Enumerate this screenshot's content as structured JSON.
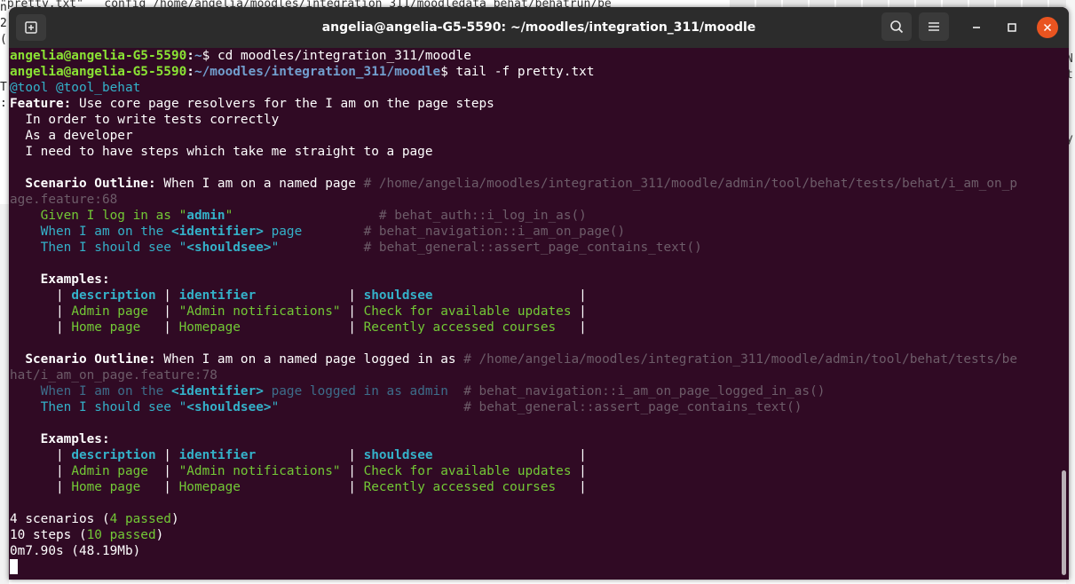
{
  "background": {
    "top_text": "\"pretty.txt\"   config /home/angelia/moodles/integration_311/moodledata_behat/behatrun/be",
    "left_text": "n\n2\n(\n\n\nT\n:",
    "right_glyphs": "\nN\nt\n\n\n\ny"
  },
  "window": {
    "title": "angelia@angelia-G5-5590: ~/moodles/integration_311/moodle"
  },
  "terminal": {
    "prompt_user": "angelia@angelia-G5-5590",
    "cmd1_path": "~",
    "cmd1": "cd moodles/integration_311/moodle",
    "cmd2_path": "~/moodles/integration_311/moodle",
    "cmd2": "tail -f pretty.txt",
    "tags": "@tool @tool_behat",
    "feature_kw": "Feature:",
    "feature_title": " Use core page resolvers for the I am on the page steps",
    "narrative": [
      "  In order to write tests correctly",
      "  As a developer",
      "  I need to have steps which take me straight to a page"
    ],
    "scenario1": {
      "kw": "  Scenario Outline:",
      "title": " When I am on a named page ",
      "path1": "# /home/angelia/moodles/integration_311/moodle/admin/tool/behat/tests/behat/i_am_on_p",
      "path2": "age.feature:68",
      "steps": [
        {
          "kw": "    Given",
          "text1": " I log in as \"",
          "arg": "admin",
          "text2": "\"",
          "pad": "                   ",
          "ref": "# behat_auth::i_log_in_as()"
        },
        {
          "kw": "    When",
          "text1": " I am on the ",
          "arg": "<identifier>",
          "text2": " page",
          "pad": "        ",
          "ref": "# behat_navigation::i_am_on_page()"
        },
        {
          "kw": "    Then",
          "text1": " I should see \"",
          "arg": "<shouldsee>",
          "text2": "\"",
          "pad": "           ",
          "ref": "# behat_general::assert_page_contains_text()"
        }
      ],
      "examples_kw": "    Examples:",
      "header": [
        "description",
        "identifier",
        "shouldsee"
      ],
      "rows": [
        [
          "Admin page",
          "\"Admin notifications\"",
          "Check for available updates"
        ],
        [
          "Home page",
          "Homepage",
          "Recently accessed courses"
        ]
      ]
    },
    "scenario2": {
      "kw": "  Scenario Outline:",
      "title": " When I am on a named page logged in as ",
      "path1": "# /home/angelia/moodles/integration_311/moodle/admin/tool/behat/tests/be",
      "path2": "hat/i_am_on_page.feature:78",
      "steps": [
        {
          "kw": "    When",
          "text1": " I am on the ",
          "arg": "<identifier>",
          "text2": " page logged in as admin",
          "pad": "  ",
          "ref": "# behat_navigation::i_am_on_page_logged_in_as()"
        },
        {
          "kw": "    Then",
          "text1": " I should see \"",
          "arg": "<shouldsee>",
          "text2": "\"",
          "pad": "                        ",
          "ref": "# behat_general::assert_page_contains_text()"
        }
      ],
      "examples_kw": "    Examples:",
      "header": [
        "description",
        "identifier",
        "shouldsee"
      ],
      "rows": [
        [
          "Admin page",
          "\"Admin notifications\"",
          "Check for available updates"
        ],
        [
          "Home page",
          "Homepage",
          "Recently accessed courses"
        ]
      ]
    },
    "summary": {
      "scenarios_pre": "4 scenarios (",
      "scenarios_passed": "4 passed",
      "scenarios_post": ")",
      "steps_pre": "10 steps (",
      "steps_passed": "10 passed",
      "steps_post": ")",
      "time": "0m7.90s (48.19Mb)"
    }
  },
  "colors": {
    "terminal_bg": "#300a24",
    "titlebar_bg": "#2c2c2c",
    "close_button": "#e95420",
    "prompt_green": "#8ae234",
    "path_blue": "#729fcf",
    "step_green": "#73c936",
    "cyan": "#34b1c9",
    "comment": "#6d5c69"
  }
}
